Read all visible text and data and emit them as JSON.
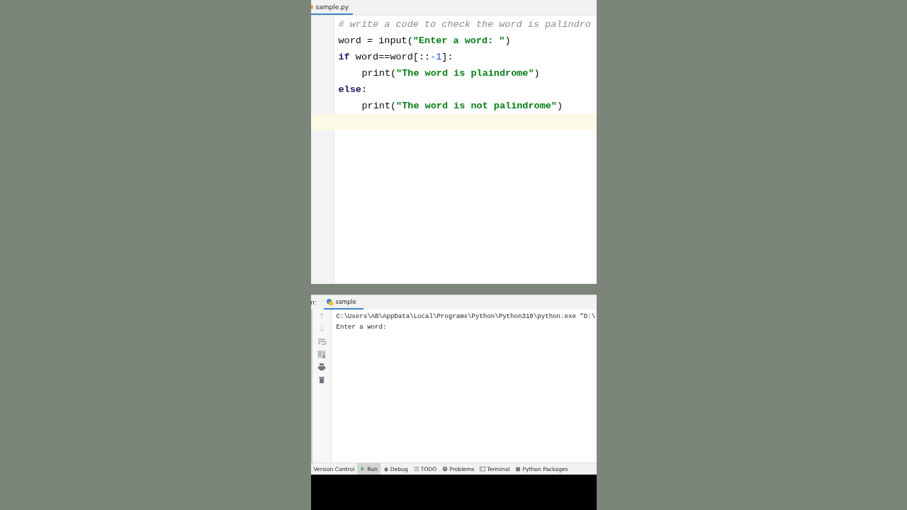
{
  "editor": {
    "tab": {
      "label": "sample.py",
      "selected": true
    },
    "lines": [
      {
        "indented": false,
        "tokens": [
          {
            "text": "# write a code to check the word is palindro",
            "kind": "comment"
          }
        ]
      },
      {
        "indented": false,
        "tokens": [
          {
            "text": "word = input(",
            "kind": "plain"
          },
          {
            "text": "\"Enter a word: \"",
            "kind": "string"
          },
          {
            "text": ")",
            "kind": "plain"
          }
        ]
      },
      {
        "indented": false,
        "tokens": [
          {
            "text": "if",
            "kind": "keyword"
          },
          {
            "text": " word==word[::",
            "kind": "plain"
          },
          {
            "text": "-1",
            "kind": "number"
          },
          {
            "text": "]:",
            "kind": "plain"
          }
        ]
      },
      {
        "indented": true,
        "tokens": [
          {
            "text": "print(",
            "kind": "plain"
          },
          {
            "text": "\"The word is plaindrome\"",
            "kind": "string"
          },
          {
            "text": ")",
            "kind": "plain"
          }
        ]
      },
      {
        "indented": false,
        "tokens": [
          {
            "text": "else",
            "kind": "keyword"
          },
          {
            "text": ":",
            "kind": "plain"
          }
        ]
      },
      {
        "indented": true,
        "tokens": [
          {
            "text": "print(",
            "kind": "plain"
          },
          {
            "text": "\"The word is not palindrome\"",
            "kind": "string"
          },
          {
            "text": ")",
            "kind": "plain"
          }
        ]
      }
    ]
  },
  "run_panel": {
    "label": "n:",
    "tab": {
      "label": "sample",
      "selected": true
    },
    "output": [
      "C:\\Users\\AB\\AppData\\Local\\Programs\\Python\\Python310\\python.exe \"D:\\",
      "Enter a word:"
    ]
  },
  "bottom_tabs": [
    {
      "label": "Version Control",
      "selected": false
    },
    {
      "label": "Run",
      "selected": true
    },
    {
      "label": "Debug",
      "selected": false
    },
    {
      "label": "TODO",
      "selected": false
    },
    {
      "label": "Problems",
      "selected": false
    },
    {
      "label": "Terminal",
      "selected": false
    },
    {
      "label": "Python Packages",
      "selected": false
    }
  ]
}
